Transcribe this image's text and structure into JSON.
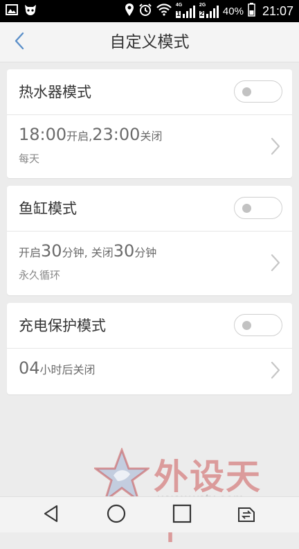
{
  "status_bar": {
    "signal1_tag": "4G",
    "signal1_num": "1",
    "signal2_tag": "2G",
    "signal2_num": "2",
    "battery": "40%",
    "time": "21:07"
  },
  "header": {
    "title": "自定义模式",
    "back_icon": "chevron-left-icon"
  },
  "modes": [
    {
      "title": "热水器模式",
      "enabled": false,
      "parts": [
        {
          "text": "18:00",
          "size": "big"
        },
        {
          "text": "开启,",
          "size": "small"
        },
        {
          "text": "23:00",
          "size": "big"
        },
        {
          "text": "关闭",
          "size": "small"
        }
      ],
      "repeat": "每天"
    },
    {
      "title": "鱼缸模式",
      "enabled": false,
      "parts": [
        {
          "text": "开启",
          "size": "small"
        },
        {
          "text": "30",
          "size": "big"
        },
        {
          "text": "分钟, 关闭",
          "size": "small"
        },
        {
          "text": "30",
          "size": "big"
        },
        {
          "text": "分钟",
          "size": "small"
        }
      ],
      "repeat": "永久循环"
    },
    {
      "title": "充电保护模式",
      "enabled": false,
      "parts": [
        {
          "text": "04",
          "size": "big"
        },
        {
          "text": "小时后关闭",
          "size": "small"
        }
      ],
      "repeat": ""
    }
  ],
  "watermark": {
    "text": "外设天下",
    "url": "www.wstx.com"
  },
  "nav_bar": {
    "icons": [
      "back-triangle-icon",
      "home-circle-icon",
      "recents-square-icon",
      "switch-sim-icon"
    ]
  },
  "colors": {
    "accent": "#5b8fc9",
    "toggle_off_knob": "#c2c2c2"
  }
}
